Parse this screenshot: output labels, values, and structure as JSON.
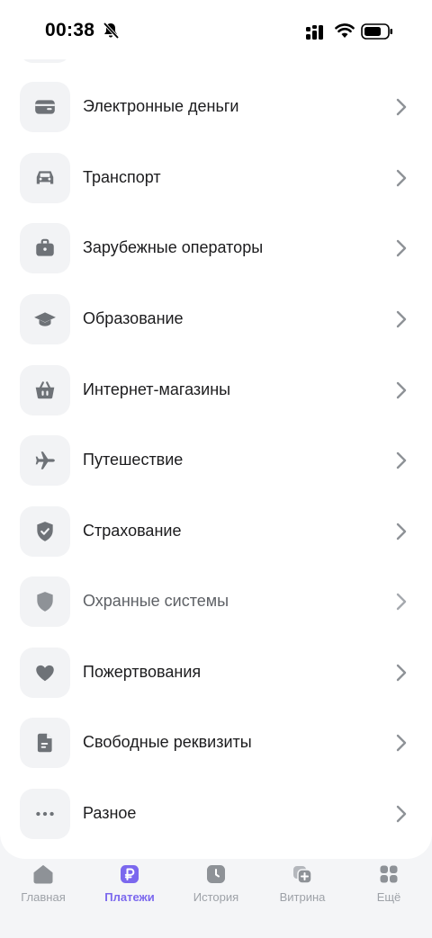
{
  "status_bar": {
    "time": "00:38",
    "icons": [
      "mute-bell-icon",
      "cellular-signal-icon",
      "wifi-icon",
      "battery-icon"
    ]
  },
  "categories": [
    {
      "label": "Электронные деньги",
      "icon": "wallet-icon"
    },
    {
      "label": "Транспорт",
      "icon": "car-icon"
    },
    {
      "label": "Зарубежные операторы",
      "icon": "briefcase-icon"
    },
    {
      "label": "Образование",
      "icon": "graduation-cap-icon"
    },
    {
      "label": "Интернет-магазины",
      "icon": "shopping-basket-icon"
    },
    {
      "label": "Путешествие",
      "icon": "airplane-icon"
    },
    {
      "label": "Страхование",
      "icon": "shield-check-icon"
    },
    {
      "label": "Охранные системы",
      "icon": "shield-icon"
    },
    {
      "label": "Пожертвования",
      "icon": "heart-icon"
    },
    {
      "label": "Свободные реквизиты",
      "icon": "document-icon"
    },
    {
      "label": "Разное",
      "icon": "more-dots-icon"
    }
  ],
  "tab_bar": {
    "items": [
      {
        "label": "Главная",
        "icon": "home-icon"
      },
      {
        "label": "Платежи",
        "icon": "ruble-icon"
      },
      {
        "label": "История",
        "icon": "clock-icon"
      },
      {
        "label": "Витрина",
        "icon": "showcase-add-icon"
      },
      {
        "label": "Ещё",
        "icon": "grid-icon"
      }
    ],
    "active_index": 1
  },
  "colors": {
    "accent": "#7b68ee",
    "icon_gray": "#6e7277",
    "icon_tile": "#f2f3f5",
    "inactive_tab": "#9ea2a8"
  }
}
